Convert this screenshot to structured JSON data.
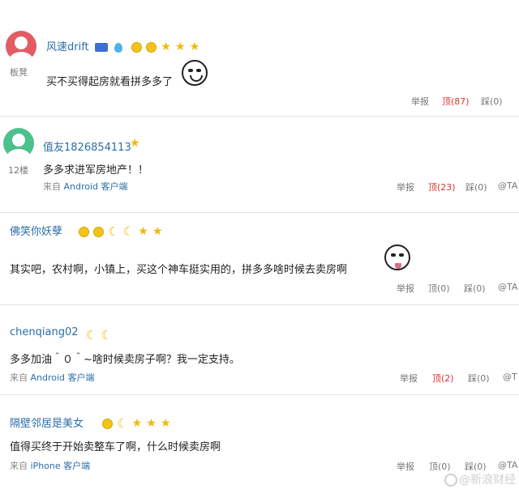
{
  "comments": [
    {
      "username": "风速drift",
      "floor": "板凳",
      "text": "买不买得起房就看拼多多了",
      "actions": {
        "report": "举报",
        "up": "顶(87)",
        "down": "踩(0)"
      },
      "avatar_color": "#e35b63"
    },
    {
      "username": "值友1826854113",
      "floor": "12楼",
      "text": "多多求进军房地产！！",
      "source_prefix": "来自",
      "source_client": "Android 客户端",
      "actions": {
        "report": "举报",
        "up": "顶(23)",
        "down": "踩(0)",
        "at": "@TA"
      },
      "avatar_color": "#4cc08d"
    },
    {
      "username": "佛笑你妖孽",
      "text": "其实吧，农村啊，小镇上，买这个神车挺实用的，拼多多啥时候去卖房啊",
      "actions": {
        "report": "举报",
        "up": "顶(0)",
        "down": "踩(0)",
        "at": "@TA"
      }
    },
    {
      "username": "chenqiang02",
      "text": "多多加油＾０＾~啥时候卖房子啊？我一定支持。",
      "source_prefix": "来自",
      "source_client": "Android 客户端",
      "actions": {
        "report": "举报",
        "up": "顶(2)",
        "down": "踩(0)",
        "at": "@T"
      }
    },
    {
      "username": "隔壁邻居是美女",
      "text": "值得买终于开始卖整车了啊，什么时候卖房啊",
      "source_prefix": "来自",
      "source_client": "iPhone 客户端",
      "actions": {
        "report": "举报",
        "up": "顶(0)",
        "down": "踩(0)",
        "at": "@TA"
      }
    }
  ],
  "watermark": "@新浪财经",
  "colors": {
    "link": "#2b6ea8",
    "hot": "#d33333",
    "badge": "#f2b705"
  }
}
